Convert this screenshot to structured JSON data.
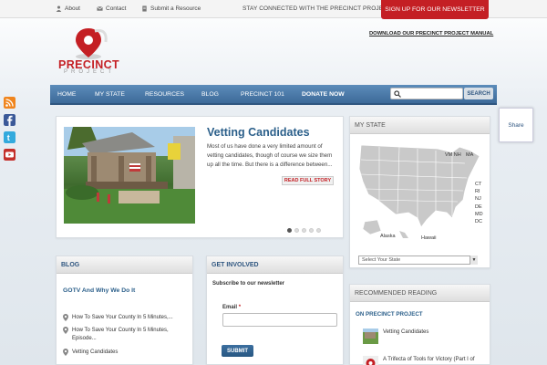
{
  "topbar": {
    "about": "About",
    "contact": "Contact",
    "submit_resource": "Submit a Resource",
    "stay_connected": "STAY CONNECTED WITH THE PRECINCT PROJECT",
    "signup": "SIGN UP FOR OUR NEWSLETTER"
  },
  "logo": {
    "word": "PRECINCT",
    "sub": "PROJECT"
  },
  "header": {
    "manual_link": "DOWNLOAD OUR PRECINCT PROJECT MANUAL"
  },
  "nav": {
    "items": [
      "HOME",
      "MY STATE",
      "RESOURCES",
      "BLOG",
      "PRECINCT 101",
      "DONATE NOW"
    ],
    "search_button": "SEARCH",
    "search_placeholder": ""
  },
  "social": [
    "rss-icon",
    "facebook-icon",
    "twitter-icon",
    "youtube-icon"
  ],
  "share": {
    "label": "Share"
  },
  "feature": {
    "title": "Vetting Candidates",
    "excerpt": "Most of us have done a very limited amount of vetting candidates, though of course we size them up all the time. But there is a difference between...",
    "read_more": "READ FULL STORY",
    "slides": 5,
    "active_slide": 1
  },
  "my_state": {
    "heading": "MY STATE",
    "labels": [
      "VM NH",
      "MA",
      "CT",
      "RI",
      "NJ",
      "DE",
      "MD",
      "DC",
      "Alaska",
      "Hawaii"
    ],
    "select_placeholder": "Select Your State"
  },
  "blog": {
    "heading": "BLOG",
    "post_title": "GOTV And Why We Do It",
    "items": [
      "How To Save Your County In 5 Minutes,...",
      "How To Save Your County In 5 Minutes, Episode...",
      "Vetting Candidates"
    ]
  },
  "get_involved": {
    "heading": "GET INVOLVED",
    "subscribe_label": "Subscribe to our newsletter",
    "email_label": "Email",
    "required_mark": "*",
    "submit": "SUBMIT"
  },
  "recommended": {
    "heading": "RECOMMENDED READING",
    "section": "ON PRECINCT PROJECT",
    "items": [
      "Vetting Candidates",
      "A Trifecta of Tools for Victory (Part I of"
    ]
  },
  "colors": {
    "brand_red": "#c41f24",
    "nav_blue": "#4a7aab",
    "link_blue": "#2b5f8a"
  }
}
